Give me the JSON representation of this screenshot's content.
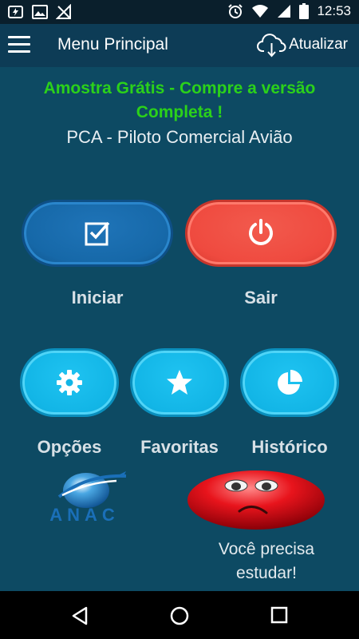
{
  "status_bar": {
    "time": "12:53",
    "left_icons": [
      "battery-charging-icon",
      "image-icon",
      "no-signal-icon"
    ],
    "right_icons": [
      "alarm-icon",
      "wifi-icon",
      "signal-icon",
      "battery-icon"
    ]
  },
  "app_bar": {
    "title": "Menu Principal",
    "refresh_label": "Atualizar",
    "menu_icon": "hamburger-menu-icon",
    "refresh_icon": "cloud-download-icon"
  },
  "promo": {
    "line1": "Amostra Grátis - Compre a versão",
    "line2": "Completa !",
    "color": "#2bd11a"
  },
  "subtitle": "PCA - Piloto Comercial Avião",
  "main_buttons": {
    "start_label": "Iniciar",
    "start_icon": "checkbox-icon",
    "exit_label": "Sair",
    "exit_icon": "power-icon"
  },
  "secondary_buttons": {
    "options_label": "Opções",
    "options_icon": "gear-icon",
    "favorites_label": "Favoritas",
    "favorites_icon": "star-icon",
    "history_label": "Histórico",
    "history_icon": "pie-chart-icon"
  },
  "logo": {
    "text": "ANAC"
  },
  "feedback": {
    "line1": "Você precisa",
    "line2": "estudar!",
    "face_icon": "sad-face-icon"
  },
  "nav_bar": {
    "icons": [
      "back-icon",
      "home-icon",
      "recent-apps-icon"
    ]
  },
  "colors": {
    "background": "#0d4a63",
    "app_bar": "#0d3c56",
    "start_button": "#1668a8",
    "exit_button": "#ef4a3f",
    "secondary_button": "#12b5e6"
  }
}
